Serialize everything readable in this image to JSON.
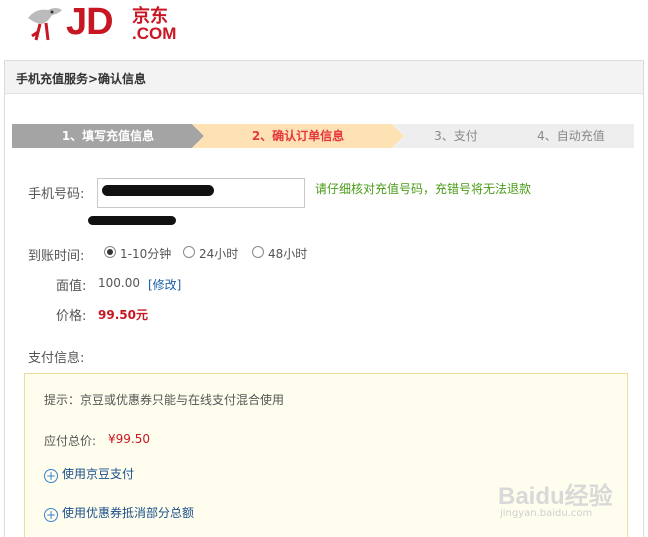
{
  "brand": {
    "logo_main": "JD",
    "logo_cn": "京东",
    "logo_com": ".COM"
  },
  "header": {
    "title": "手机充值服务>确认信息"
  },
  "steps": [
    {
      "label": "1、填写充值信息"
    },
    {
      "label": "2、确认订单信息"
    },
    {
      "label": "3、支付"
    },
    {
      "label": "4、自动充值"
    }
  ],
  "form": {
    "phone_label": "手机号码:",
    "phone_hint": "请仔细核对充值号码，充错号将无法退款",
    "arrival_label": "到账时间:",
    "arrival_options": [
      {
        "label": "1-10分钟",
        "selected": true
      },
      {
        "label": "24小时",
        "selected": false
      },
      {
        "label": "48小时",
        "selected": false
      }
    ],
    "face_value_label": "面值:",
    "face_value": "100.00",
    "modify_link": "[修改]",
    "price_label": "价格:",
    "price_value": "99.50元"
  },
  "payment": {
    "section_title": "支付信息:",
    "tip": "提示：京豆或优惠券只能与在线支付混合使用",
    "total_label": "应付总价:",
    "total_value": "¥99.50",
    "option_jingdou": "使用京豆支付",
    "option_coupon": "使用优惠券抵消部分总额"
  },
  "watermark": {
    "main": "Baidu经验",
    "sub": "jingyan.baidu.com"
  },
  "colors": {
    "brand_red": "#c81623",
    "active_step_bg": "#ffe2b4",
    "hint_green": "#4a9b1a",
    "link_blue": "#1a5fa8"
  }
}
